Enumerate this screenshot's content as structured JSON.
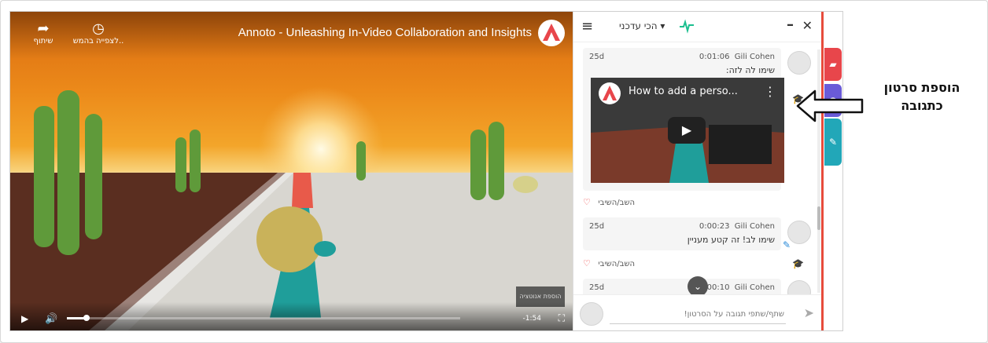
{
  "video": {
    "title": "Annoto - Unleashing In-Video Collaboration and Insights",
    "share_label": "שיתוף",
    "watch_later_label": "לצפייה בהמש..",
    "time_remaining": "-1:54",
    "mini_preview_label": "הוספת אנוטציה",
    "progress": 0.05
  },
  "panel": {
    "sort_label": "הכי עדכני",
    "comments": [
      {
        "time": "25d",
        "author": "Gili Cohen",
        "timestamp": "0:01:06",
        "text": "שימו לה לזה:",
        "embed_title": "How to add a perso...",
        "reply_label": "השב/השיבי"
      },
      {
        "time": "25d",
        "author": "Gili Cohen",
        "timestamp": "0:00:23",
        "text": "שימו לב! זה קטע מעניין",
        "reply_label": "השב/השיבי"
      },
      {
        "time": "25d",
        "author": "Gili Cohen",
        "timestamp": "0:00:10",
        "text": ""
      }
    ],
    "composer_placeholder": "שתף/שתפי תגובה על הסרטון!"
  },
  "annotation": {
    "line1": "הוספת סרטון",
    "line2": "כתגובה"
  },
  "colors": {
    "accent_red": "#e74c3c",
    "tab_purple": "#6a5bd8",
    "tab_teal": "#22a7b8",
    "pulse_green": "#1bbf8f"
  },
  "icons": [
    "share-icon",
    "clock-icon",
    "annoto-logo",
    "play-icon",
    "volume-icon",
    "fullscreen-icon",
    "menu-icon",
    "pulse-icon",
    "minimize-icon",
    "close-icon",
    "graduation-cap-icon",
    "pencil-icon",
    "heart-icon",
    "chevron-down-icon",
    "send-icon",
    "arrow-left-icon"
  ]
}
